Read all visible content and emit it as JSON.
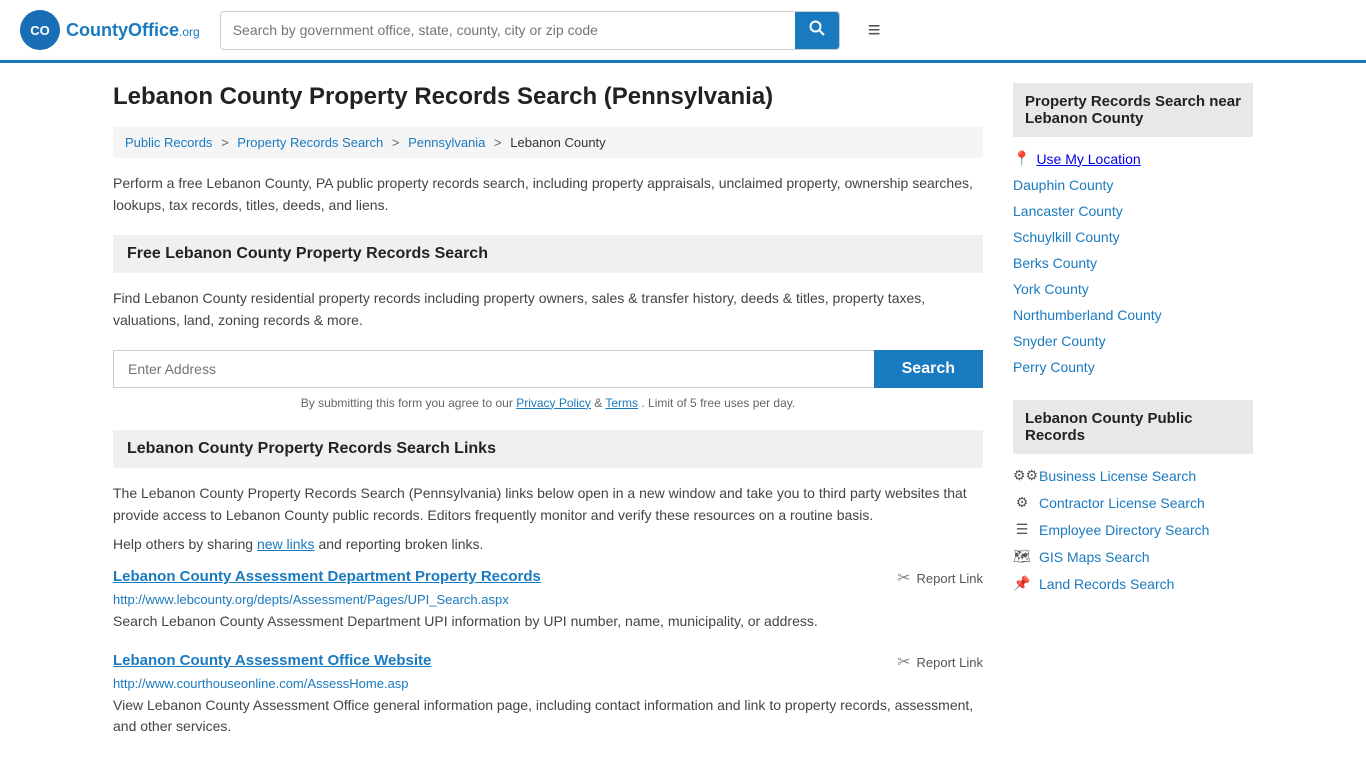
{
  "header": {
    "logo_text": "County",
    "logo_suffix": "Office.org",
    "search_placeholder": "Search by government office, state, county, city or zip code"
  },
  "page": {
    "title": "Lebanon County Property Records Search (Pennsylvania)",
    "description": "Perform a free Lebanon County, PA public property records search, including property appraisals, unclaimed property, ownership searches, lookups, tax records, titles, deeds, and liens."
  },
  "breadcrumb": {
    "items": [
      "Public Records",
      "Property Records Search",
      "Pennsylvania",
      "Lebanon County"
    ]
  },
  "free_search": {
    "header": "Free Lebanon County Property Records Search",
    "description": "Find Lebanon County residential property records including property owners, sales & transfer history, deeds & titles, property taxes, valuations, land, zoning records & more.",
    "address_placeholder": "Enter Address",
    "search_label": "Search",
    "form_note": "By submitting this form you agree to our",
    "privacy_label": "Privacy Policy",
    "and_text": "&",
    "terms_label": "Terms",
    "limit_note": ". Limit of 5 free uses per day."
  },
  "links_section": {
    "header": "Lebanon County Property Records Search Links",
    "description": "The Lebanon County Property Records Search (Pennsylvania) links below open in a new window and take you to third party websites that provide access to Lebanon County public records. Editors frequently monitor and verify these resources on a routine basis.",
    "share_text": "Help others by sharing",
    "new_links_label": "new links",
    "and_text": "and reporting broken links.",
    "records": [
      {
        "title": "Lebanon County Assessment Department Property Records",
        "url": "http://www.lebcounty.org/depts/Assessment/Pages/UPI_Search.aspx",
        "description": "Search Lebanon County Assessment Department UPI information by UPI number, name, municipality, or address.",
        "report_label": "Report Link"
      },
      {
        "title": "Lebanon County Assessment Office Website",
        "url": "http://www.courthouseonline.com/AssessHome.asp",
        "description": "View Lebanon County Assessment Office general information page, including contact information and link to property records, assessment, and other services.",
        "report_label": "Report Link"
      }
    ]
  },
  "sidebar": {
    "nearby_header": "Property Records Search near Lebanon County",
    "use_location_label": "Use My Location",
    "nearby_counties": [
      "Dauphin County",
      "Lancaster County",
      "Schuylkill County",
      "Berks County",
      "York County",
      "Northumberland County",
      "Snyder County",
      "Perry County"
    ],
    "public_records_header": "Lebanon County Public Records",
    "public_records_links": [
      {
        "icon": "⚙",
        "label": "Business License Search"
      },
      {
        "icon": "⚙",
        "label": "Contractor License Search"
      },
      {
        "icon": "☰",
        "label": "Employee Directory Search"
      },
      {
        "icon": "🗺",
        "label": "GIS Maps Search"
      },
      {
        "icon": "📌",
        "label": "Land Records Search"
      }
    ]
  }
}
